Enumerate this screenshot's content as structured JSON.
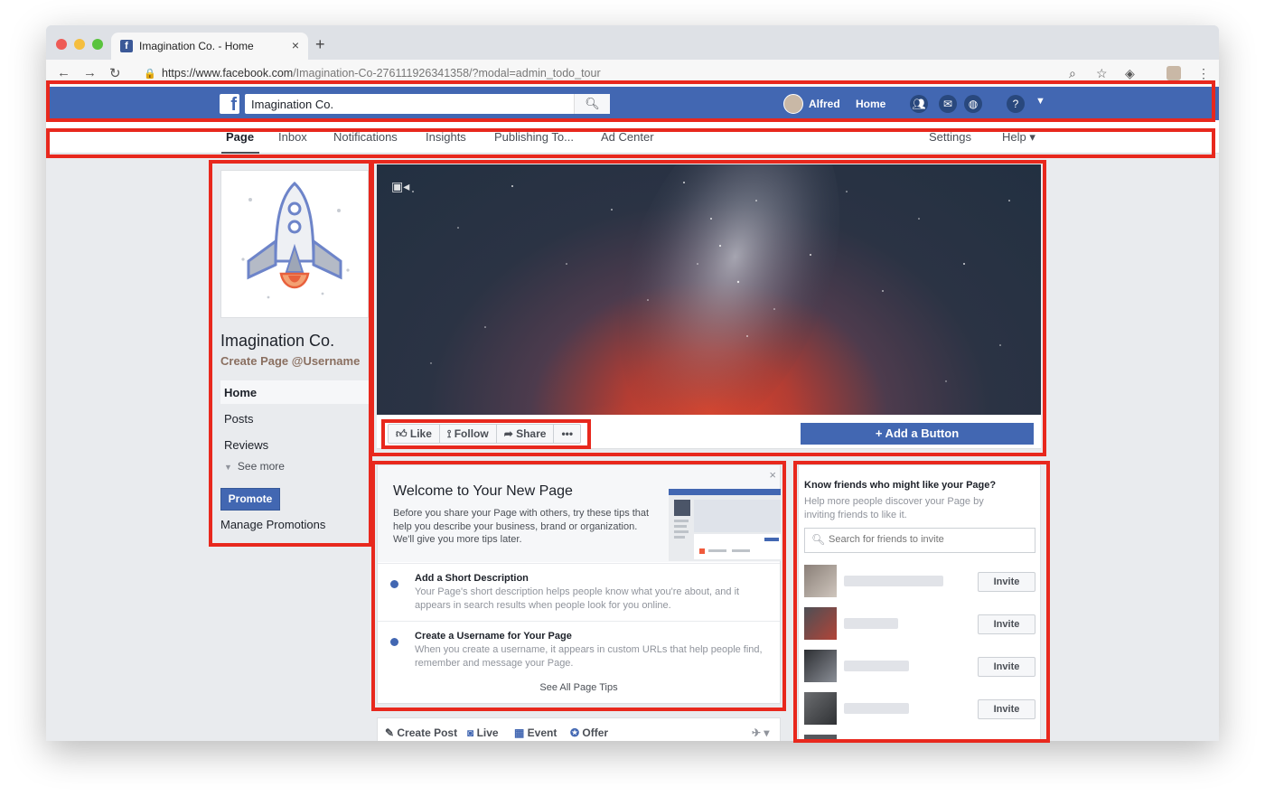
{
  "browser": {
    "tab_title": "Imagination Co. - Home",
    "tab_close": "×",
    "new_tab": "+",
    "url_main": "https://www.facebook.com",
    "url_rest": "/Imagination-Co-276111926341358/?modal=admin_todo_tour"
  },
  "topbar": {
    "logo": "f",
    "search_value": "Imagination Co.",
    "user_name": "Alfred",
    "home_label": "Home"
  },
  "page_nav": {
    "items": [
      "Page",
      "Inbox",
      "Notifications",
      "Insights",
      "Publishing To...",
      "Ad Center"
    ],
    "settings": "Settings",
    "help": "Help ▾"
  },
  "sidebar": {
    "page_name": "Imagination Co.",
    "username_cta": "Create Page @Username",
    "items": [
      "Home",
      "Posts",
      "Reviews"
    ],
    "see_more": "See more",
    "promote": "Promote",
    "manage_promotions": "Manage Promotions"
  },
  "cover": {
    "actions": [
      "Like",
      "Follow",
      "Share",
      "•••"
    ],
    "add_button": "+ Add a Button"
  },
  "welcome": {
    "title": "Welcome to Your New Page",
    "intro": "Before you share your Page with others, try these tips that help you describe your business, brand or organization. We'll give you more tips later.",
    "tips": [
      {
        "title": "Add a Short Description",
        "desc": "Your Page's short description helps people know what you're about, and it appears in search results when people look for you online."
      },
      {
        "title": "Create a Username for Your Page",
        "desc": "When you create a username, it appears in custom URLs that help people find, remember and message your Page."
      }
    ],
    "see_all": "See All Page Tips",
    "close": "×"
  },
  "composer": {
    "items": [
      "Create Post",
      "Live",
      "Event",
      "Offer"
    ]
  },
  "invite": {
    "title": "Know friends who might like your Page?",
    "desc": "Help more people discover your Page by inviting friends to like it.",
    "search_placeholder": "Search for friends to invite",
    "invite_label": "Invite"
  },
  "colors": {
    "facebook_blue": "#4267b2",
    "highlight_red": "#e8281d"
  }
}
